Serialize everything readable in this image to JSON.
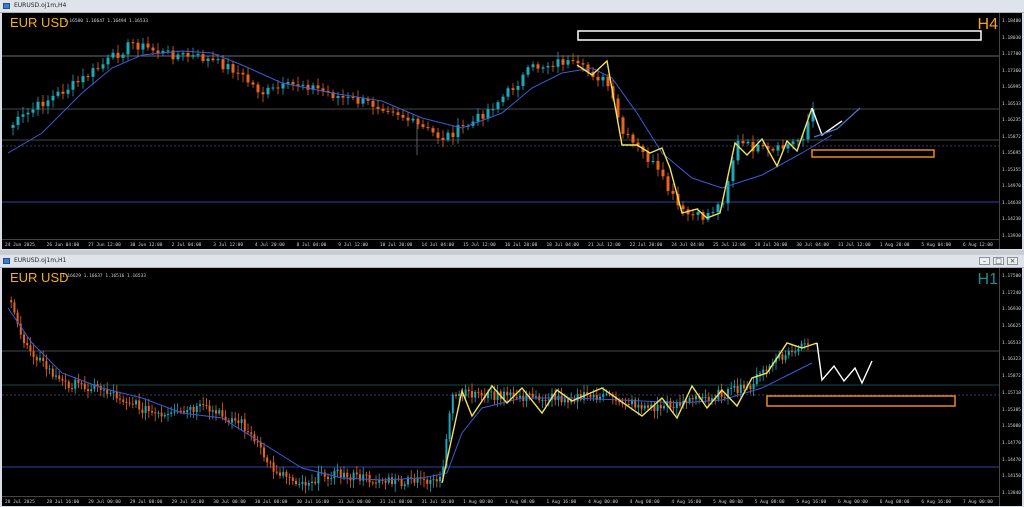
{
  "top": {
    "window_title": "EURUSD.oj1m,H4",
    "symbol": "EUR USD",
    "ohlc": "1.16580 1.16647 1.16494 1.16533",
    "timeframe": "H4",
    "timeframe_color": "#f5a31a",
    "price_ticks": [
      "1.18400",
      "1.18030",
      "1.17700",
      "1.17360",
      "1.16995",
      "1.16533",
      "1.16235",
      "1.15872",
      "1.15695",
      "1.15355",
      "1.14970",
      "1.14638",
      "1.14230",
      "1.13930"
    ],
    "time_ticks": [
      "24 Jun 2025",
      "26 Jun 04:00",
      "27 Jun 12:00",
      "30 Jun 12:00",
      "2 Jul 04:00",
      "3 Jul 12:00",
      "4 Jul 20:00",
      "8 Jul 04:00",
      "9 Jul 12:00",
      "10 Jul 20:00",
      "14 Jul 04:00",
      "15 Jul 12:00",
      "16 Jul 20:00",
      "18 Jul 04:00",
      "21 Jul 12:00",
      "22 Jul 20:00",
      "24 Jul 04:00",
      "25 Jul 12:00",
      "28 Jul 20:00",
      "30 Jul 04:00",
      "31 Jul 12:00",
      "1 Aug 20:00",
      "5 Aug 04:00",
      "6 Aug 12:00"
    ]
  },
  "bottom": {
    "window_title": "EURUSD.oj1m,H1",
    "symbol": "EUR USD",
    "ohlc": "1.16629 1.16637 1.16516 1.16533",
    "timeframe": "H1",
    "timeframe_color": "#1f8f8f",
    "price_ticks": [
      "1.17500",
      "1.17240",
      "1.16930",
      "1.16625",
      "1.16533",
      "1.16323",
      "1.15872",
      "1.15718",
      "1.15385",
      "1.15080",
      "1.14770",
      "1.14470",
      "1.14150",
      "1.13840"
    ],
    "time_ticks": [
      "28 Jul 2025",
      "28 Jul 16:00",
      "29 Jul 00:00",
      "29 Jul 08:00",
      "29 Jul 16:00",
      "30 Jul 00:00",
      "30 Jul 08:00",
      "30 Jul 16:00",
      "31 Jul 00:00",
      "31 Jul 08:00",
      "31 Jul 16:00",
      "1 Aug 00:00",
      "1 Aug 08:00",
      "1 Aug 16:00",
      "4 Aug 00:00",
      "4 Aug 08:00",
      "4 Aug 16:00",
      "5 Aug 00:00",
      "5 Aug 08:00",
      "5 Aug 16:00",
      "6 Aug 00:00",
      "6 Aug 08:00",
      "6 Aug 16:00",
      "7 Aug 00:00"
    ]
  },
  "colors": {
    "bull": "#1fa7b8",
    "bear": "#e8631e",
    "ma": "#3a5bd9",
    "zigzag": "#f2e35a",
    "projection": "#ffffff",
    "supply": "#ffffff",
    "demand": "#f08a1e"
  }
}
